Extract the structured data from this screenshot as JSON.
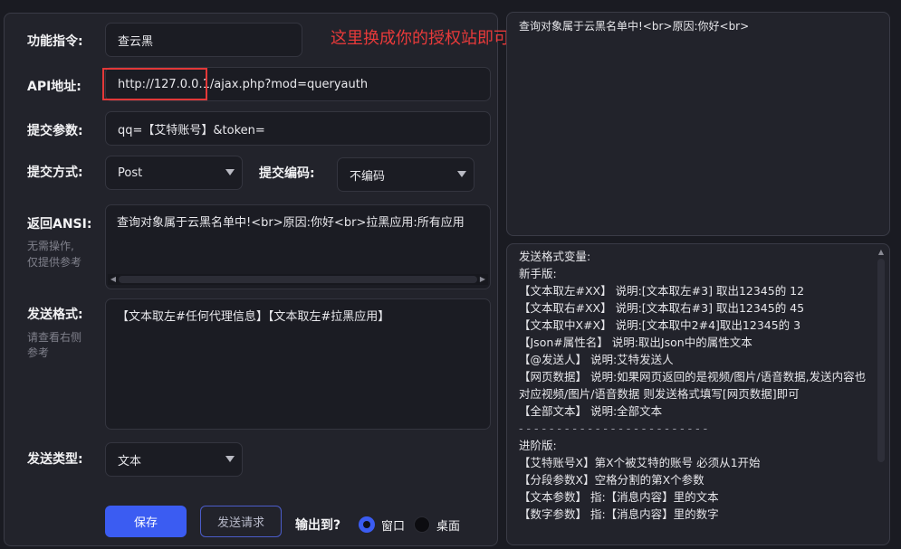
{
  "form": {
    "command": {
      "label": "功能指令:",
      "value": "查云黑"
    },
    "api": {
      "label": "API地址:",
      "value": "http://127.0.0.1/ajax.php?mod=queryauth"
    },
    "params": {
      "label": "提交参数:",
      "value": "qq=【艾特账号】&token="
    },
    "method": {
      "label": "提交方式:",
      "value": "Post"
    },
    "encoding": {
      "label": "提交编码:",
      "value": "不编码"
    },
    "return_ansi": {
      "label": "返回ANSI:",
      "hint_line1": "无需操作,",
      "hint_line2": "仅提供参考",
      "value": "查询对象属于云黑名单中!<br>原因:你好<br>拉黑应用:所有应用"
    },
    "send_format": {
      "label": "发送格式:",
      "hint_line1": "请查看右侧",
      "hint_line2": "参考",
      "value": "【文本取左#任何代理信息】【文本取左#拉黑应用】"
    },
    "send_type": {
      "label": "发送类型:",
      "value": "文本"
    },
    "save_label": "保存",
    "request_label": "发送请求",
    "output": {
      "label": "输出到?",
      "opt_window": "窗口",
      "opt_desktop": "桌面",
      "selected": "窗口"
    }
  },
  "annotation": {
    "text": "这里换成你的授权站即可",
    "color": "#e83a3a"
  },
  "response_preview": "查询对象属于云黑名单中!<br>原因:你好<br>",
  "help_lines": [
    "发送格式变量:",
    "新手版:",
    "【文本取左#XX】  说明:[文本取左#3] 取出12345的 12",
    "【文本取右#XX】  说明:[文本取右#3] 取出12345的 45",
    "【文本取中X#X】  说明:[文本取中2#4]取出12345的 3",
    "【Json#属性名】  说明:取出Json中的属性文本",
    "【@发送人】      说明:艾特发送人",
    "【网页数据】     说明:如果网页返回的是视频/图片/语音数据,发送内容也对应视频/图片/语音数据 则发送格式填写[网页数据]即可",
    "【全部文本】  说明:全部文本",
    "- - - - - - - - - - - - - - - - - - - - - - - - -",
    "进阶版:",
    "【艾特账号X】第X个被艾特的账号 必须从1开始",
    "【分段参数X】空格分割的第X个参数",
    "【文本参数】 指:【消息内容】里的文本",
    "【数字参数】 指:【消息内容】里的数字"
  ],
  "colors": {
    "background": "#1a1b22",
    "panel": "#22232b",
    "input": "#1b1c23",
    "accent": "#3b5cf2",
    "highlight_box": "#e33838"
  }
}
